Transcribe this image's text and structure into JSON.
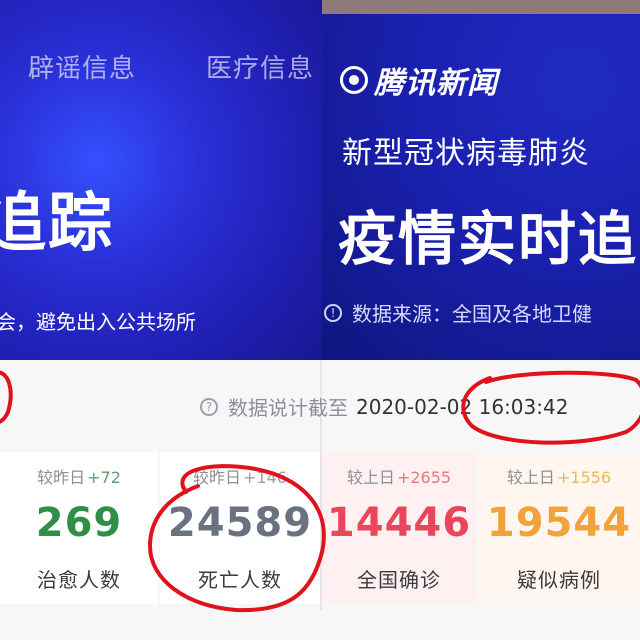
{
  "left_panel": {
    "tabs": [
      "辟谣信息",
      "医疗信息"
    ],
    "title": "追踪",
    "subtitle": "会，避免出入公共场所"
  },
  "right_panel": {
    "brand": "腾讯新闻",
    "headline_small": "新型冠状病毒肺炎",
    "headline_big": "疫情实时追",
    "source": "数据来源：全国及各地卫健"
  },
  "stats": {
    "note_prefix": "数据说",
    "note_mid": "计截至",
    "note_time": "2020-02-02 16:03:42",
    "cards": [
      {
        "compare": "较昨日",
        "delta": "+72",
        "value": "269",
        "label": "治愈人数",
        "color": "#2f8f46"
      },
      {
        "compare": "较昨日",
        "delta": "+146",
        "value": "24589",
        "label": "死亡人数",
        "color": "#6a7280"
      },
      {
        "compare": "较上日",
        "delta": "+2655",
        "value": "14446",
        "label": "全国确诊",
        "color": "#e8465a"
      },
      {
        "compare": "较上日",
        "delta": "+1556",
        "value": "19544",
        "label": "疑似病例",
        "color": "#f3a23b"
      }
    ]
  },
  "icons": [
    "info-circle-icon",
    "tencent-logo-icon"
  ],
  "colors": {
    "header_blue": "#2a2fd6",
    "annotation_red": "#e0121c"
  }
}
